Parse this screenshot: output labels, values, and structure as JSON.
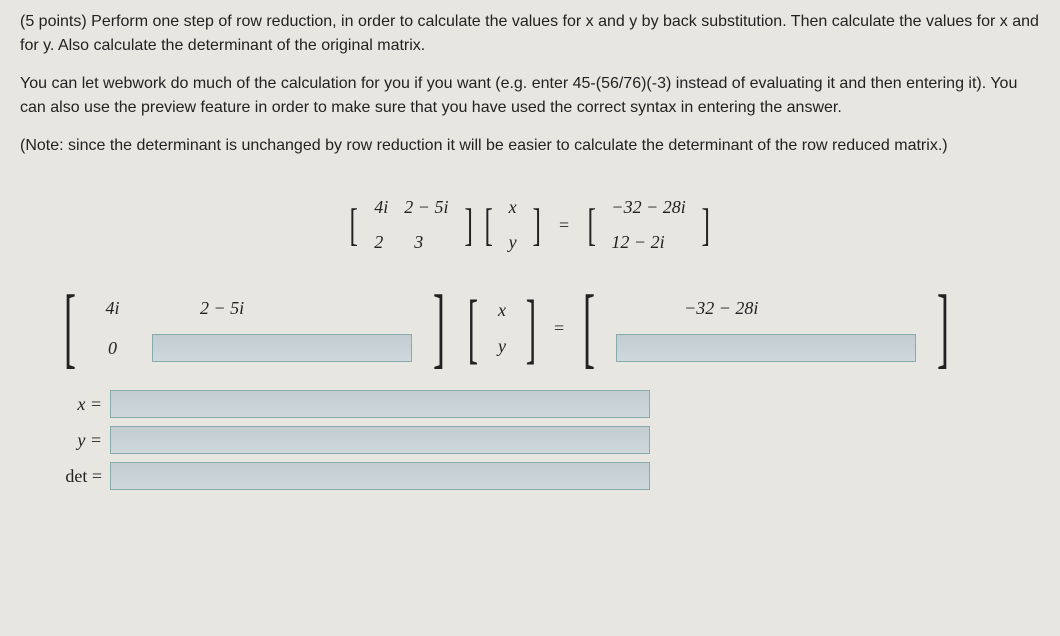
{
  "problem": {
    "points_text": "(5 points)",
    "p1": "Perform one step of row reduction, in order to calculate the values for x and y by back substitution. Then calculate the values for x and for y. Also calculate the determinant of the original matrix.",
    "p2": "You can let webwork do much of the calculation for you if you want (e.g. enter 45-(56/76)(-3) instead of evaluating it and then entering it). You can also use the preview feature in order to make sure that you have used the correct syntax in entering the answer.",
    "p3": "(Note: since the determinant is unchanged by row reduction it will be easier to calculate the determinant of the row reduced matrix.)"
  },
  "equation": {
    "a11": "4i",
    "a12": "2 − 5i",
    "a21": "2",
    "a22": "3",
    "x": "x",
    "y": "y",
    "b1": "−32 − 28i",
    "b2": "12 − 2i"
  },
  "work_matrix": {
    "a11": "4i",
    "a12": "2 − 5i",
    "a21": "0",
    "a22_input": "",
    "x": "x",
    "y": "y",
    "b1": "−32 − 28i",
    "b2_input": ""
  },
  "answers": {
    "x_label": "x =",
    "y_label": "y =",
    "det_label": "det =",
    "x_value": "",
    "y_value": "",
    "det_value": ""
  },
  "symbols": {
    "equals": "="
  }
}
